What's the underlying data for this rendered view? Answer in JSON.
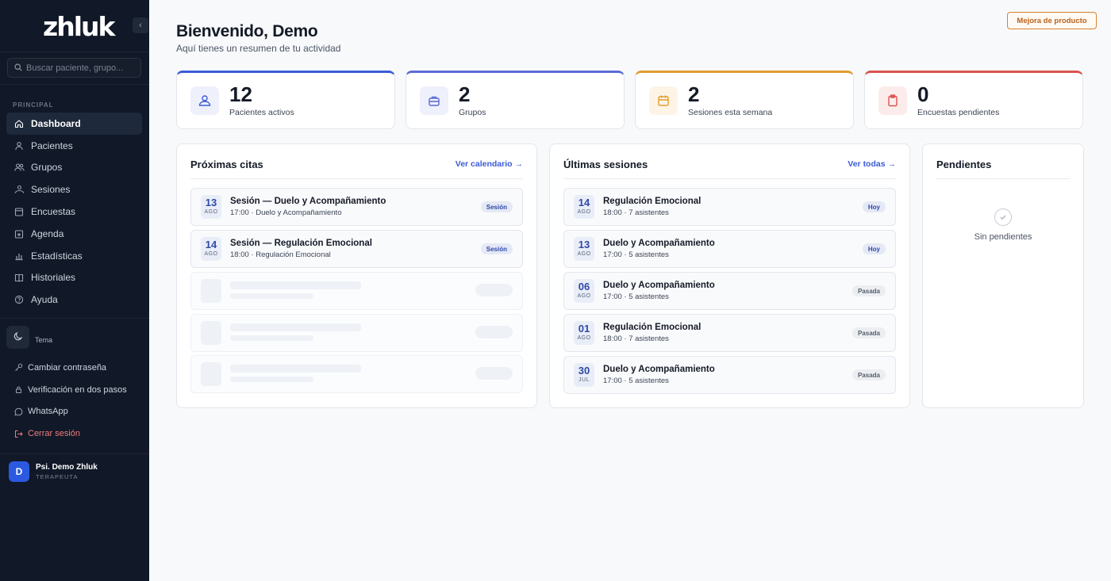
{
  "sidebar": {
    "logo": "zhluk",
    "collapse_label": "‹",
    "search_placeholder": "Buscar paciente, grupo...",
    "section_label": "PRINCIPAL",
    "nav": [
      {
        "label": "Dashboard",
        "icon": "home-icon",
        "active": true
      },
      {
        "label": "Pacientes",
        "icon": "user-icon"
      },
      {
        "label": "Grupos",
        "icon": "users-icon"
      },
      {
        "label": "Sesiones",
        "icon": "group-icon"
      },
      {
        "label": "Encuestas",
        "icon": "survey-icon"
      },
      {
        "label": "Agenda",
        "icon": "calendar-icon"
      },
      {
        "label": "Estadísticas",
        "icon": "chart-icon"
      },
      {
        "label": "Historiales",
        "icon": "book-icon"
      },
      {
        "label": "Ayuda",
        "icon": "help-icon"
      }
    ],
    "theme_label": "Tema",
    "actions": [
      {
        "label": "Cambiar contraseña",
        "icon": "key-icon"
      },
      {
        "label": "Verificación en dos pasos",
        "icon": "lock-icon"
      },
      {
        "label": "WhatsApp",
        "icon": "whatsapp-icon"
      },
      {
        "label": "Cerrar sesión",
        "icon": "logout-icon"
      }
    ],
    "user": {
      "initial": "D",
      "name": "Psi. Demo Zhluk",
      "role": "TERAPEUTA"
    }
  },
  "header": {
    "title": "Bienvenido, Demo",
    "subtitle": "Aquí tienes un resumen de tu actividad",
    "feedback_button": "Mejora de producto"
  },
  "stats": [
    {
      "value": "12",
      "label": "Pacientes activos",
      "icon": "patients-icon",
      "accent": "#3b5bd6",
      "tint": "#eef1fb"
    },
    {
      "value": "2",
      "label": "Grupos",
      "icon": "briefcase-icon",
      "accent": "#5b6bd6",
      "tint": "#eef0fb"
    },
    {
      "value": "2",
      "label": "Sesiones esta semana",
      "icon": "calendar-icon",
      "accent": "#e39b2e",
      "tint": "#fdf4e6"
    },
    {
      "value": "0",
      "label": "Encuestas pendientes",
      "icon": "clipboard-icon",
      "accent": "#d9534f",
      "tint": "#fbeceb"
    }
  ],
  "upcoming": {
    "title": "Próximas citas",
    "link": "Ver calendario →",
    "items": [
      {
        "day": "13",
        "month": "AGO",
        "title": "Sesión — Duelo y Acompañamiento",
        "subtitle": "17:00 · Duelo y Acompañamiento",
        "badge": "Sesión"
      },
      {
        "day": "14",
        "month": "AGO",
        "title": "Sesión — Regulación Emocional",
        "subtitle": "18:00 · Regulación Emocional",
        "badge": "Sesión"
      }
    ]
  },
  "recent": {
    "title": "Últimas sesiones",
    "link": "Ver todas →",
    "items": [
      {
        "day": "14",
        "month": "AGO",
        "title": "Regulación Emocional",
        "subtitle": "18:00 · 7 asistentes",
        "badge": "Hoy"
      },
      {
        "day": "13",
        "month": "AGO",
        "title": "Duelo y Acompañamiento",
        "subtitle": "17:00 · 5 asistentes",
        "badge": "Hoy"
      },
      {
        "day": "06",
        "month": "AGO",
        "title": "Duelo y Acompañamiento",
        "subtitle": "17:00 · 5 asistentes",
        "badge": "Pasada"
      },
      {
        "day": "01",
        "month": "AGO",
        "title": "Regulación Emocional",
        "subtitle": "18:00 · 7 asistentes",
        "badge": "Pasada"
      },
      {
        "day": "30",
        "month": "JUL",
        "title": "Duelo y Acompañamiento",
        "subtitle": "17:00 · 5 asistentes",
        "badge": "Pasada"
      }
    ]
  },
  "pending": {
    "title": "Pendientes",
    "empty_text": "Sin pendientes"
  }
}
